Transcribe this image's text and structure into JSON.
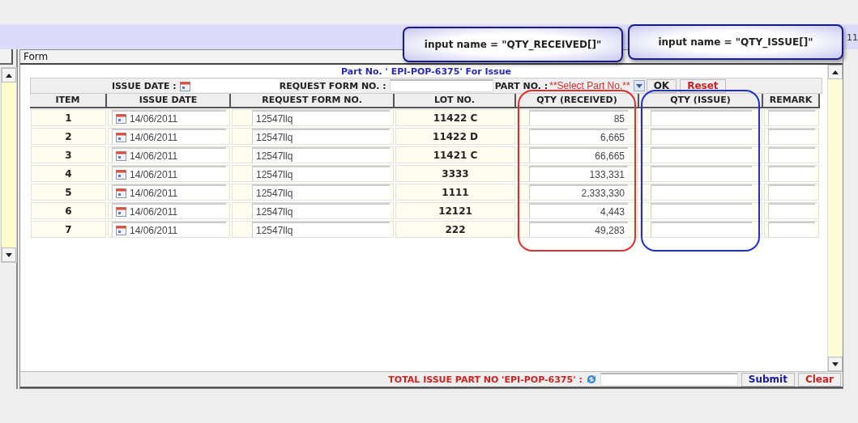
{
  "corner_text": "11",
  "panel": {
    "title": "Form"
  },
  "heading": "Part No. ' EPI-POP-6375' For Issue",
  "filter": {
    "issue_date_label": "ISSUE DATE :",
    "request_label": "REQUEST FORM NO. :",
    "part_label": "PART NO. :",
    "part_select": "**Select Part No.**",
    "ok_button": "OK",
    "reset_button": "Reset"
  },
  "columns": [
    "ITEM",
    "ISSUE DATE",
    "REQUEST FORM NO.",
    "LOT NO.",
    "QTY (RECEIVED)",
    "QTY (ISSUE)",
    "REMARK"
  ],
  "rows": [
    {
      "item": "1",
      "issue_date": "14/06/2011",
      "request_no": "12547llq",
      "lot": "11422 C",
      "qty_received": "85"
    },
    {
      "item": "2",
      "issue_date": "14/06/2011",
      "request_no": "12547llq",
      "lot": "11422 D",
      "qty_received": "6,665"
    },
    {
      "item": "3",
      "issue_date": "14/06/2011",
      "request_no": "12547llq",
      "lot": "11421 C",
      "qty_received": "66,665"
    },
    {
      "item": "4",
      "issue_date": "14/06/2011",
      "request_no": "12547llq",
      "lot": "3333",
      "qty_received": "133,331"
    },
    {
      "item": "5",
      "issue_date": "14/06/2011",
      "request_no": "12547llq",
      "lot": "1111",
      "qty_received": "2,333,330"
    },
    {
      "item": "6",
      "issue_date": "14/06/2011",
      "request_no": "12547llq",
      "lot": "12121",
      "qty_received": "4,443"
    },
    {
      "item": "7",
      "issue_date": "14/06/2011",
      "request_no": "12547llq",
      "lot": "222",
      "qty_received": "49,283"
    }
  ],
  "footer": {
    "total_label": "TOTAL ISSUE PART NO 'EPI-POP-6375' :",
    "submit_button": "Submit",
    "clear_button": "Clear"
  },
  "callouts": [
    {
      "text": "input name = \"QTY_RECEIVED[]\"",
      "color": "#e03030"
    },
    {
      "text": "input name = \"QTY_ISSUE[]\"",
      "color": "#2030d0"
    }
  ]
}
